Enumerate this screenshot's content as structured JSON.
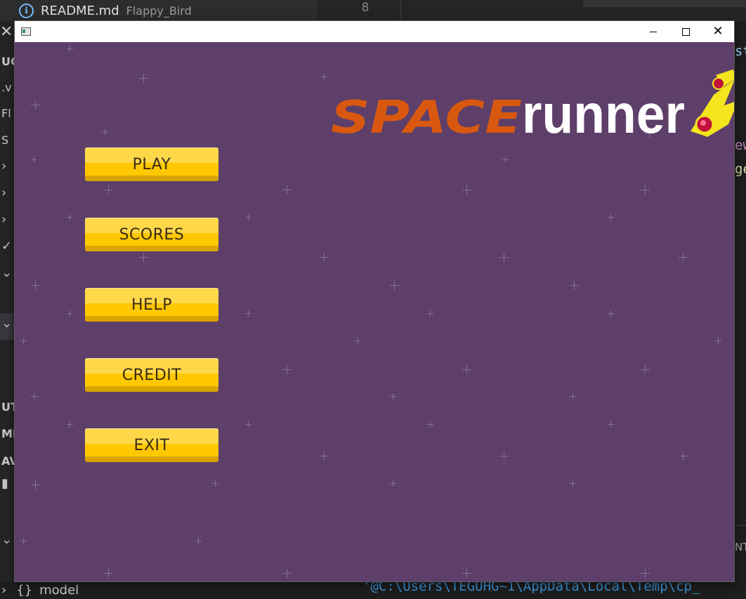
{
  "editor": {
    "tab": {
      "name": "README.md",
      "description": "Flappy_Bird"
    },
    "line_number": "8",
    "sidebar_labels": [
      ".v",
      "Fl",
      "S",
      "UT",
      "MI",
      "AVA"
    ],
    "section_label": "UG",
    "bottom_item": {
      "brace": "{}",
      "label": "model"
    },
    "code_fragments": {
      "top": "st",
      "mid1": "ew",
      "mid2": "ge",
      "nt": "NT"
    },
    "terminal_text": "'@C:\\Users\\TEGUHG~1\\AppData\\Local\\Temp\\cp_"
  },
  "game_window": {
    "title": "",
    "controls": {
      "minimize": "–",
      "maximize": "□",
      "close": "✕"
    },
    "logo": {
      "part1": "SPACE",
      "part2": "runner"
    },
    "menu": [
      {
        "id": "play",
        "label": "PLAY"
      },
      {
        "id": "scores",
        "label": "SCORES"
      },
      {
        "id": "help",
        "label": "HELP"
      },
      {
        "id": "credit",
        "label": "CREDIT"
      },
      {
        "id": "exit",
        "label": "EXIT"
      }
    ],
    "colors": {
      "background": "#5d3f6a",
      "button": "#ffc800",
      "logo_orange": "#d9580f",
      "logo_white": "#ffffff"
    }
  }
}
